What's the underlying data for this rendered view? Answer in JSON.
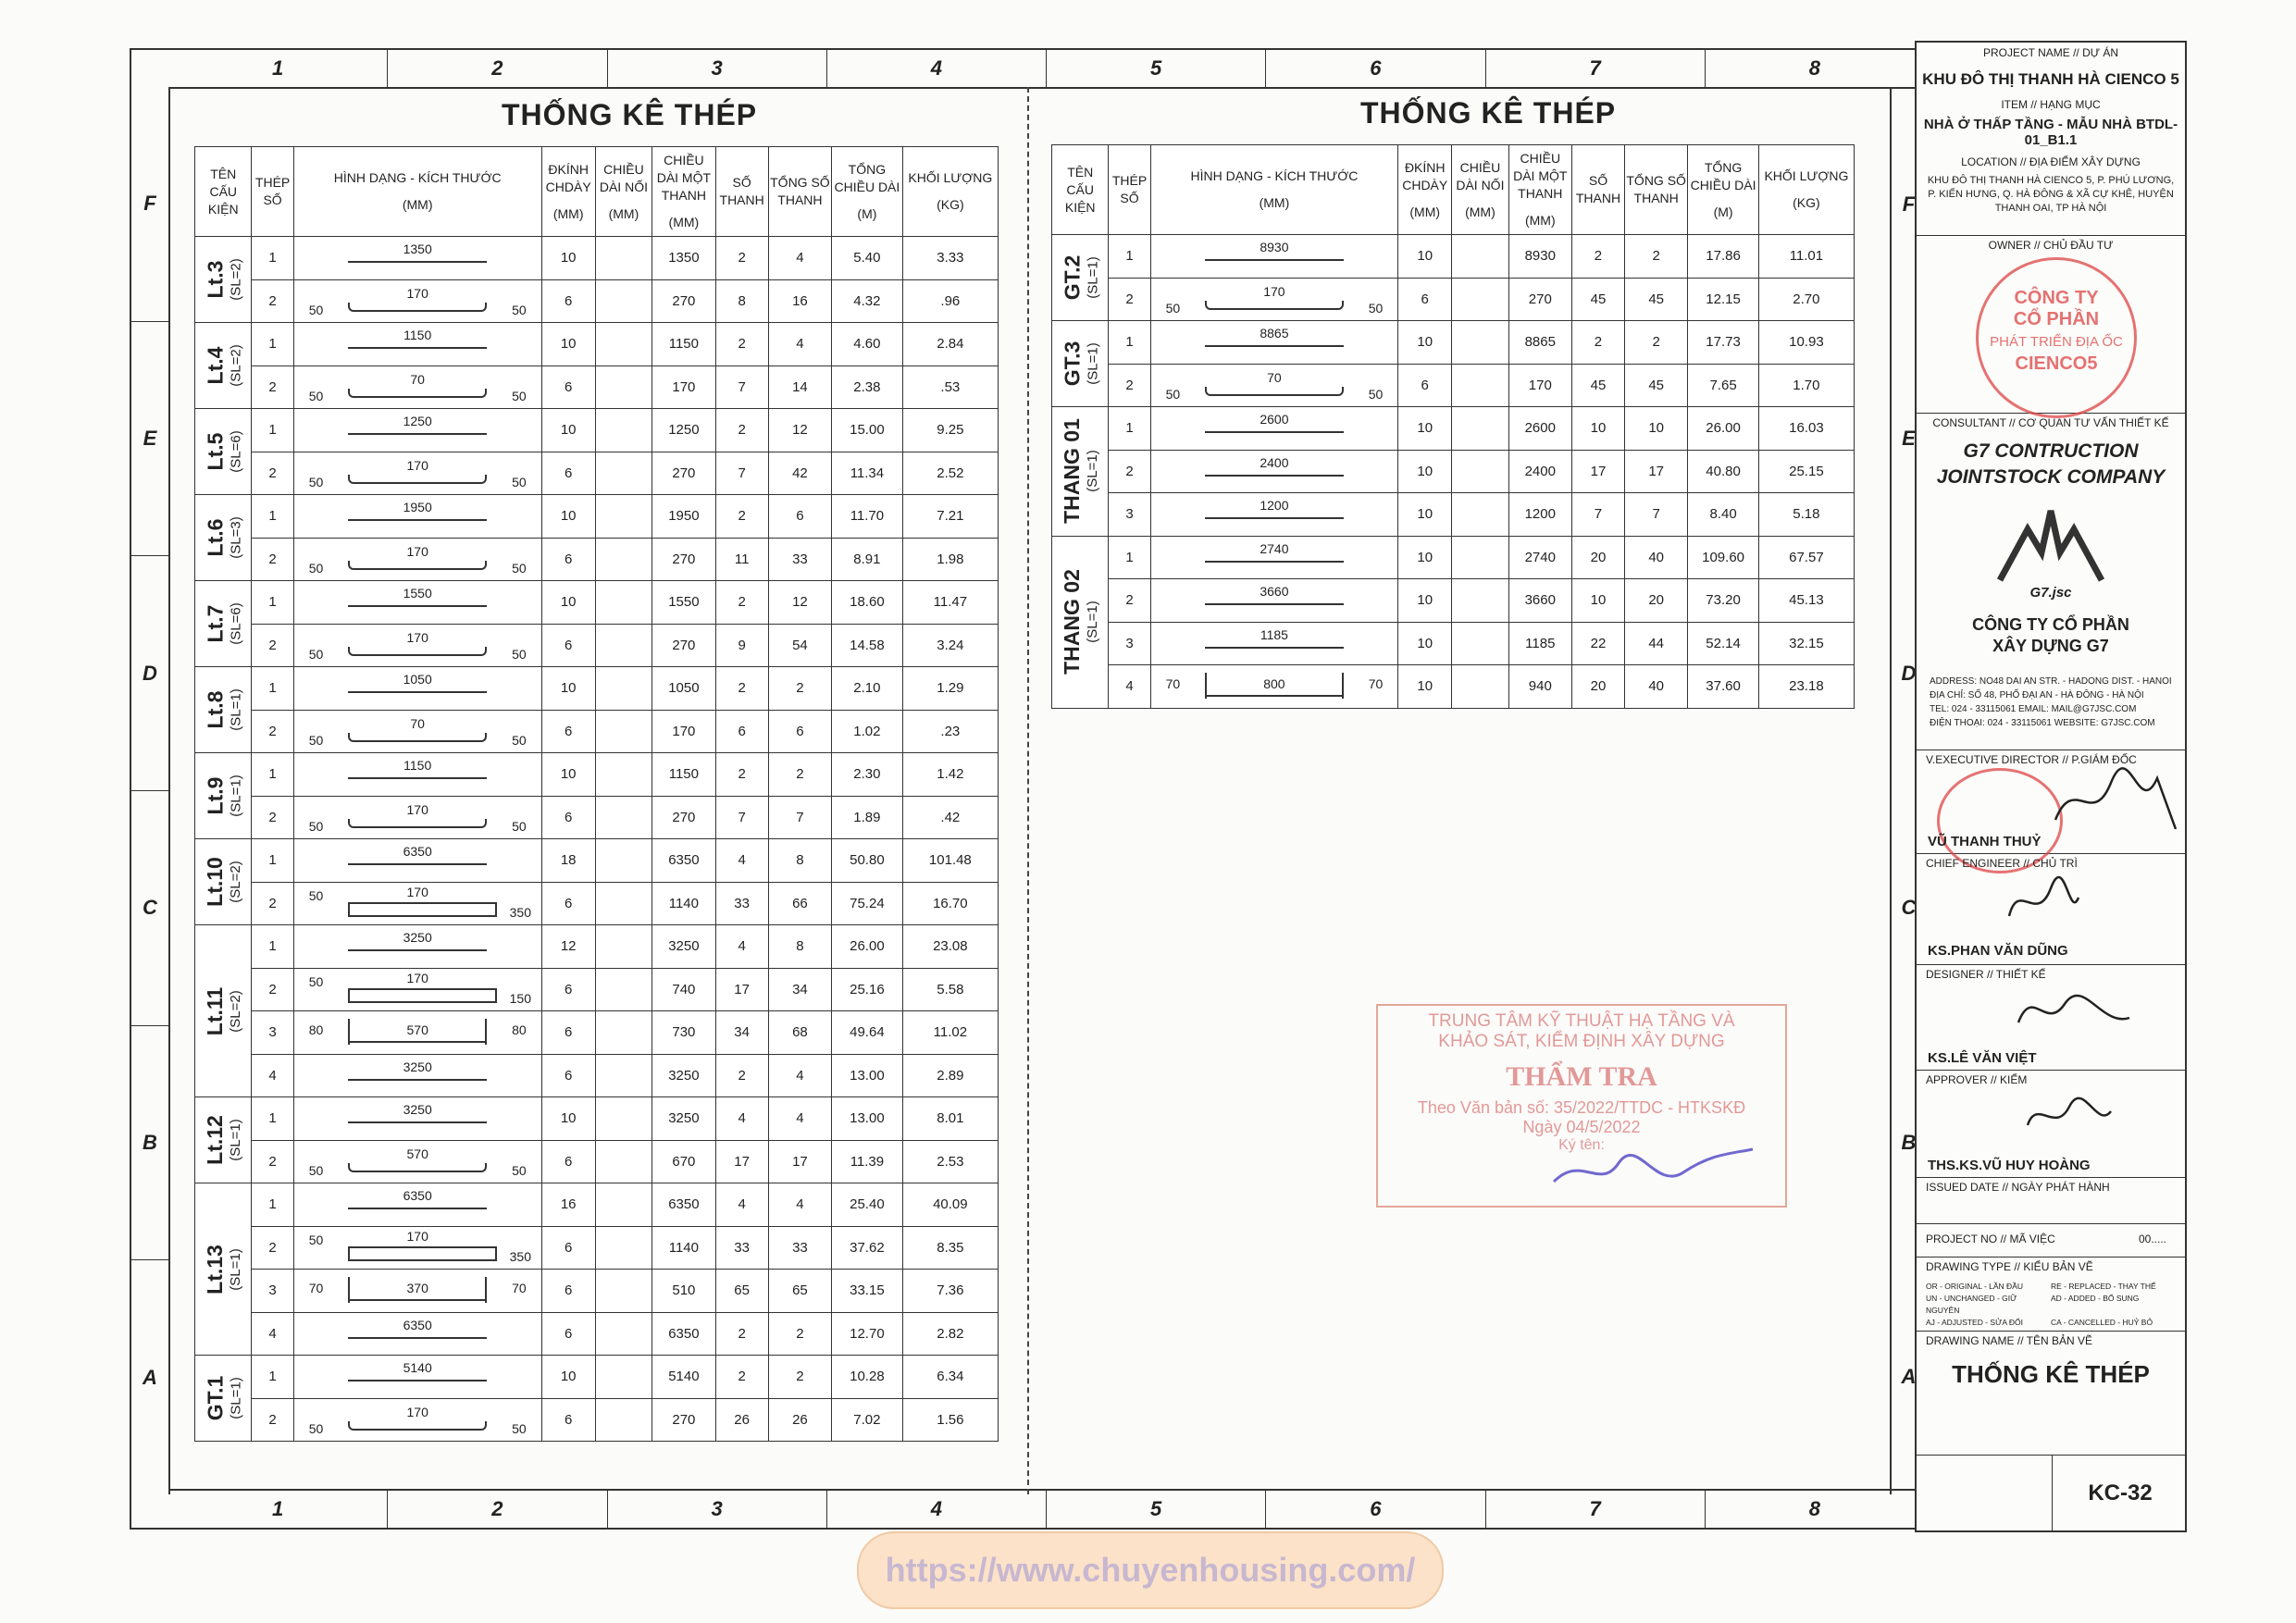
{
  "sheet": {
    "columns": [
      "1",
      "2",
      "3",
      "4",
      "5",
      "6",
      "7",
      "8"
    ],
    "rows": [
      "F",
      "E",
      "D",
      "C",
      "B",
      "A"
    ]
  },
  "left_table": {
    "title": "THỐNG KÊ THÉP",
    "headers": {
      "member": "TÊN CẤU KIỆN",
      "bar_no": "THÉP SỐ",
      "shape": "HÌNH DẠNG - KÍCH THƯỚC",
      "shape_unit": "(MM)",
      "dia": "ĐKÍNH CHDÀY",
      "dia_unit": "(MM)",
      "lap": "CHIỀU DÀI NỐI",
      "lap_unit": "(MM)",
      "len_one": "CHIỀU DÀI MỘT THANH",
      "len_unit": "(MM)",
      "count": "SỐ THANH",
      "total_count": "TỔNG SỐ THANH",
      "total_len": "TỔNG CHIỀU DÀI",
      "total_len_unit": "(M)",
      "weight": "KHỐI LƯỢNG",
      "weight_unit": "(KG)"
    },
    "groups": [
      {
        "name": "Lt.3",
        "sl": "(SL=2)",
        "rows": [
          {
            "no": "1",
            "shape": {
              "type": "straight",
              "main": "1350"
            },
            "dia": "10",
            "len": "1350",
            "n": "2",
            "tn": "4",
            "tl": "5.40",
            "w": "3.33"
          },
          {
            "no": "2",
            "shape": {
              "type": "hook",
              "main": "170",
              "left": "50",
              "right": "50"
            },
            "dia": "6",
            "len": "270",
            "n": "8",
            "tn": "16",
            "tl": "4.32",
            "w": ".96"
          }
        ]
      },
      {
        "name": "Lt.4",
        "sl": "(SL=2)",
        "rows": [
          {
            "no": "1",
            "shape": {
              "type": "straight",
              "main": "1150"
            },
            "dia": "10",
            "len": "1150",
            "n": "2",
            "tn": "4",
            "tl": "4.60",
            "w": "2.84"
          },
          {
            "no": "2",
            "shape": {
              "type": "hook",
              "main": "70",
              "left": "50",
              "right": "50"
            },
            "dia": "6",
            "len": "170",
            "n": "7",
            "tn": "14",
            "tl": "2.38",
            "w": ".53"
          }
        ]
      },
      {
        "name": "Lt.5",
        "sl": "(SL=6)",
        "rows": [
          {
            "no": "1",
            "shape": {
              "type": "straight",
              "main": "1250"
            },
            "dia": "10",
            "len": "1250",
            "n": "2",
            "tn": "12",
            "tl": "15.00",
            "w": "9.25"
          },
          {
            "no": "2",
            "shape": {
              "type": "hook",
              "main": "170",
              "left": "50",
              "right": "50"
            },
            "dia": "6",
            "len": "270",
            "n": "7",
            "tn": "42",
            "tl": "11.34",
            "w": "2.52"
          }
        ]
      },
      {
        "name": "Lt.6",
        "sl": "(SL=3)",
        "rows": [
          {
            "no": "1",
            "shape": {
              "type": "straight",
              "main": "1950"
            },
            "dia": "10",
            "len": "1950",
            "n": "2",
            "tn": "6",
            "tl": "11.70",
            "w": "7.21"
          },
          {
            "no": "2",
            "shape": {
              "type": "hook",
              "main": "170",
              "left": "50",
              "right": "50"
            },
            "dia": "6",
            "len": "270",
            "n": "11",
            "tn": "33",
            "tl": "8.91",
            "w": "1.98"
          }
        ]
      },
      {
        "name": "Lt.7",
        "sl": "(SL=6)",
        "rows": [
          {
            "no": "1",
            "shape": {
              "type": "straight",
              "main": "1550"
            },
            "dia": "10",
            "len": "1550",
            "n": "2",
            "tn": "12",
            "tl": "18.60",
            "w": "11.47"
          },
          {
            "no": "2",
            "shape": {
              "type": "hook",
              "main": "170",
              "left": "50",
              "right": "50"
            },
            "dia": "6",
            "len": "270",
            "n": "9",
            "tn": "54",
            "tl": "14.58",
            "w": "3.24"
          }
        ]
      },
      {
        "name": "Lt.8",
        "sl": "(SL=1)",
        "rows": [
          {
            "no": "1",
            "shape": {
              "type": "straight",
              "main": "1050"
            },
            "dia": "10",
            "len": "1050",
            "n": "2",
            "tn": "2",
            "tl": "2.10",
            "w": "1.29"
          },
          {
            "no": "2",
            "shape": {
              "type": "hook",
              "main": "70",
              "left": "50",
              "right": "50"
            },
            "dia": "6",
            "len": "170",
            "n": "6",
            "tn": "6",
            "tl": "1.02",
            "w": ".23"
          }
        ]
      },
      {
        "name": "Lt.9",
        "sl": "(SL=1)",
        "rows": [
          {
            "no": "1",
            "shape": {
              "type": "straight",
              "main": "1150"
            },
            "dia": "10",
            "len": "1150",
            "n": "2",
            "tn": "2",
            "tl": "2.30",
            "w": "1.42"
          },
          {
            "no": "2",
            "shape": {
              "type": "hook",
              "main": "170",
              "left": "50",
              "right": "50"
            },
            "dia": "6",
            "len": "270",
            "n": "7",
            "tn": "7",
            "tl": "1.89",
            "w": ".42"
          }
        ]
      },
      {
        "name": "Lt.10",
        "sl": "(SL=2)",
        "rows": [
          {
            "no": "1",
            "shape": {
              "type": "straight",
              "main": "6350"
            },
            "dia": "18",
            "len": "6350",
            "n": "4",
            "tn": "8",
            "tl": "50.80",
            "w": "101.48"
          },
          {
            "no": "2",
            "shape": {
              "type": "stirrup",
              "main": "170",
              "left": "50",
              "right": "350"
            },
            "dia": "6",
            "len": "1140",
            "n": "33",
            "tn": "66",
            "tl": "75.24",
            "w": "16.70"
          }
        ]
      },
      {
        "name": "Lt.11",
        "sl": "(SL=2)",
        "rows": [
          {
            "no": "1",
            "shape": {
              "type": "straight",
              "main": "3250"
            },
            "dia": "12",
            "len": "3250",
            "n": "4",
            "tn": "8",
            "tl": "26.00",
            "w": "23.08"
          },
          {
            "no": "2",
            "shape": {
              "type": "stirrup",
              "main": "170",
              "left": "50",
              "right": "150"
            },
            "dia": "6",
            "len": "740",
            "n": "17",
            "tn": "34",
            "tl": "25.16",
            "w": "5.58"
          },
          {
            "no": "3",
            "shape": {
              "type": "ubar",
              "main": "570",
              "left": "80",
              "right": "80"
            },
            "dia": "6",
            "len": "730",
            "n": "34",
            "tn": "68",
            "tl": "49.64",
            "w": "11.02"
          },
          {
            "no": "4",
            "shape": {
              "type": "straight",
              "main": "3250"
            },
            "dia": "6",
            "len": "3250",
            "n": "2",
            "tn": "4",
            "tl": "13.00",
            "w": "2.89"
          }
        ]
      },
      {
        "name": "Lt.12",
        "sl": "(SL=1)",
        "rows": [
          {
            "no": "1",
            "shape": {
              "type": "straight",
              "main": "3250"
            },
            "dia": "10",
            "len": "3250",
            "n": "4",
            "tn": "4",
            "tl": "13.00",
            "w": "8.01"
          },
          {
            "no": "2",
            "shape": {
              "type": "hook",
              "main": "570",
              "left": "50",
              "right": "50"
            },
            "dia": "6",
            "len": "670",
            "n": "17",
            "tn": "17",
            "tl": "11.39",
            "w": "2.53"
          }
        ]
      },
      {
        "name": "Lt.13",
        "sl": "(SL=1)",
        "rows": [
          {
            "no": "1",
            "shape": {
              "type": "straight",
              "main": "6350"
            },
            "dia": "16",
            "len": "6350",
            "n": "4",
            "tn": "4",
            "tl": "25.40",
            "w": "40.09"
          },
          {
            "no": "2",
            "shape": {
              "type": "stirrup",
              "main": "170",
              "left": "50",
              "right": "350"
            },
            "dia": "6",
            "len": "1140",
            "n": "33",
            "tn": "33",
            "tl": "37.62",
            "w": "8.35"
          },
          {
            "no": "3",
            "shape": {
              "type": "ubar",
              "main": "370",
              "left": "70",
              "right": "70"
            },
            "dia": "6",
            "len": "510",
            "n": "65",
            "tn": "65",
            "tl": "33.15",
            "w": "7.36"
          },
          {
            "no": "4",
            "shape": {
              "type": "straight",
              "main": "6350"
            },
            "dia": "6",
            "len": "6350",
            "n": "2",
            "tn": "2",
            "tl": "12.70",
            "w": "2.82"
          }
        ]
      },
      {
        "name": "GT.1",
        "sl": "(SL=1)",
        "rows": [
          {
            "no": "1",
            "shape": {
              "type": "straight",
              "main": "5140"
            },
            "dia": "10",
            "len": "5140",
            "n": "2",
            "tn": "2",
            "tl": "10.28",
            "w": "6.34"
          },
          {
            "no": "2",
            "shape": {
              "type": "hook",
              "main": "170",
              "left": "50",
              "right": "50"
            },
            "dia": "6",
            "len": "270",
            "n": "26",
            "tn": "26",
            "tl": "7.02",
            "w": "1.56"
          }
        ]
      }
    ]
  },
  "right_table": {
    "title": "THỐNG KÊ THÉP",
    "groups": [
      {
        "name": "GT.2",
        "sl": "(SL=1)",
        "rows": [
          {
            "no": "1",
            "shape": {
              "type": "straight",
              "main": "8930"
            },
            "dia": "10",
            "len": "8930",
            "n": "2",
            "tn": "2",
            "tl": "17.86",
            "w": "11.01"
          },
          {
            "no": "2",
            "shape": {
              "type": "hook",
              "main": "170",
              "left": "50",
              "right": "50"
            },
            "dia": "6",
            "len": "270",
            "n": "45",
            "tn": "45",
            "tl": "12.15",
            "w": "2.70"
          }
        ]
      },
      {
        "name": "GT.3",
        "sl": "(SL=1)",
        "rows": [
          {
            "no": "1",
            "shape": {
              "type": "straight",
              "main": "8865"
            },
            "dia": "10",
            "len": "8865",
            "n": "2",
            "tn": "2",
            "tl": "17.73",
            "w": "10.93"
          },
          {
            "no": "2",
            "shape": {
              "type": "hook",
              "main": "70",
              "left": "50",
              "right": "50"
            },
            "dia": "6",
            "len": "170",
            "n": "45",
            "tn": "45",
            "tl": "7.65",
            "w": "1.70"
          }
        ]
      },
      {
        "name": "THANG 01",
        "sl": "(SL=1)",
        "rows": [
          {
            "no": "1",
            "shape": {
              "type": "straight",
              "main": "2600"
            },
            "dia": "10",
            "len": "2600",
            "n": "10",
            "tn": "10",
            "tl": "26.00",
            "w": "16.03"
          },
          {
            "no": "2",
            "shape": {
              "type": "straight",
              "main": "2400"
            },
            "dia": "10",
            "len": "2400",
            "n": "17",
            "tn": "17",
            "tl": "40.80",
            "w": "25.15"
          },
          {
            "no": "3",
            "shape": {
              "type": "straight",
              "main": "1200"
            },
            "dia": "10",
            "len": "1200",
            "n": "7",
            "tn": "7",
            "tl": "8.40",
            "w": "5.18"
          }
        ]
      },
      {
        "name": "THANG 02",
        "sl": "(SL=1)",
        "rows": [
          {
            "no": "1",
            "shape": {
              "type": "straight",
              "main": "2740"
            },
            "dia": "10",
            "len": "2740",
            "n": "20",
            "tn": "40",
            "tl": "109.60",
            "w": "67.57"
          },
          {
            "no": "2",
            "shape": {
              "type": "straight",
              "main": "3660"
            },
            "dia": "10",
            "len": "3660",
            "n": "10",
            "tn": "20",
            "tl": "73.20",
            "w": "45.13"
          },
          {
            "no": "3",
            "shape": {
              "type": "straight",
              "main": "1185"
            },
            "dia": "10",
            "len": "1185",
            "n": "22",
            "tn": "44",
            "tl": "52.14",
            "w": "32.15"
          },
          {
            "no": "4",
            "shape": {
              "type": "ubar",
              "main": "800",
              "left": "70",
              "right": "70"
            },
            "dia": "10",
            "len": "940",
            "n": "20",
            "tn": "40",
            "tl": "37.60",
            "w": "23.18"
          }
        ]
      }
    ]
  },
  "title_block": {
    "project_label": "PROJECT NAME // DỰ ÁN",
    "project": "KHU ĐÔ THỊ THANH HÀ CIENCO 5",
    "item_label": "ITEM // HẠNG MỤC",
    "item": "NHÀ Ở THẤP TẦNG - MẪU NHÀ BTDL-01_B1.1",
    "location_label": "LOCATION // ĐỊA ĐIỂM XÂY DỰNG",
    "location": "KHU ĐÔ THỊ THANH HÀ CIENCO 5, P. PHÚ LƯƠNG, P. KIẾN HƯNG, Q. HÀ ĐÔNG & XÃ CỰ KHÊ, HUYỆN THANH OAI, TP HÀ NỘI",
    "owner_label": "OWNER // CHỦ ĐẦU TƯ",
    "owner_stamp": [
      "CÔNG TY",
      "CỔ PHẦN",
      "PHÁT TRIỂN ĐỊA ỐC",
      "CIENCO5"
    ],
    "consultant_label": "CONSULTANT // CƠ QUAN TƯ VẤN THIẾT KẾ",
    "consultant_line1": "G7 CONTRUCTION",
    "consultant_line2": "JOINTSTOCK COMPANY",
    "logo_text": "G7.jsc",
    "company_vn1": "CÔNG TY CỔ PHẦN",
    "company_vn2": "XÂY DỰNG G7",
    "address_lines": [
      "ADDRESS:   NO48 DAI AN STR. - HADONG DIST. - HANOI",
      "ĐỊA CHỈ:   SỐ 48, PHỐ ĐẠI AN - HÀ ĐÔNG - HÀ NỘI",
      "TEL:   024 - 33115061   EMAIL: MAIL@G7JSC.COM",
      "ĐIỆN THOẠI: 024 - 33115061   WEBSITE: G7JSC.COM"
    ],
    "director_label": "V.EXECUTIVE DIRECTOR // P.GIÁM ĐỐC",
    "director": "VŨ THANH THUỶ",
    "chief_label": "CHIEF ENGINEER // CHỦ TRÌ",
    "chief": "KS.PHAN VĂN DŨNG",
    "designer_label": "DESIGNER // THIẾT KẾ",
    "designer": "KS.LÊ VĂN VIỆT",
    "approver_label": "APPROVER // KIỂM",
    "approver": "THS.KS.VŨ HUY HOÀNG",
    "issued_label": "ISSUED DATE // NGÀY PHÁT HÀNH",
    "project_no_label": "PROJECT NO // MÃ VIỆC",
    "project_no": "00.....",
    "drawing_type_label": "DRAWING TYPE // KIỂU BẢN VẼ",
    "drawing_type_codes": [
      "OR - ORIGINAL - LẦN ĐẦU",
      "RE - REPLACED - THAY THẾ",
      "UN - UNCHANGED - GIỮ NGUYÊN",
      "AD - ADDED - BỔ SUNG",
      "AJ - ADJUSTED - SỬA ĐỔI",
      "CA - CANCELLED - HUỶ BỎ"
    ],
    "drawing_name_label": "DRAWING NAME // TÊN BẢN VẼ",
    "drawing_name": "THỐNG KÊ THÉP",
    "sheet_no": "KC-32"
  },
  "review_stamp": {
    "line1": "TRUNG TÂM KỸ THUẬT HẠ TẦNG VÀ",
    "line2": "KHẢO SÁT, KIỂM ĐỊNH XÂY DỰNG",
    "line3": "THẨM TRA",
    "line4": "Theo Văn bản số: 35/2022/TTDC - HTKSKĐ",
    "line5": "Ngày 04/5/2022",
    "line6": "Ký tên:"
  },
  "watermark": "https://www.chuyenhousing.com/"
}
